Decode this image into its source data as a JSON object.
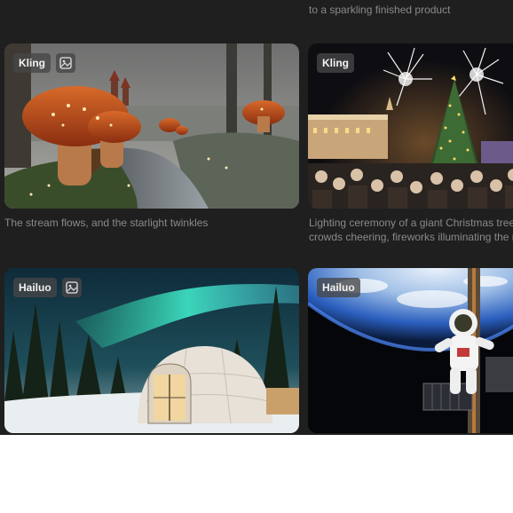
{
  "header": {
    "partial_caption_right": "to a sparkling finished product"
  },
  "cards": [
    {
      "model": "Kling",
      "has_image_icon": true,
      "icon": "image-icon",
      "caption_lines": [
        "The stream flows, and the starlight twinkles"
      ]
    },
    {
      "model": "Kling",
      "has_image_icon": false,
      "caption_lines": [
        "Lighting ceremony of a giant Christmas tree in",
        "crowds cheering, fireworks illuminating the ni"
      ]
    },
    {
      "model": "Hailuo",
      "has_image_icon": true,
      "icon": "image-icon",
      "caption_lines": []
    },
    {
      "model": "Hailuo",
      "has_image_icon": false,
      "caption_lines": []
    }
  ]
}
